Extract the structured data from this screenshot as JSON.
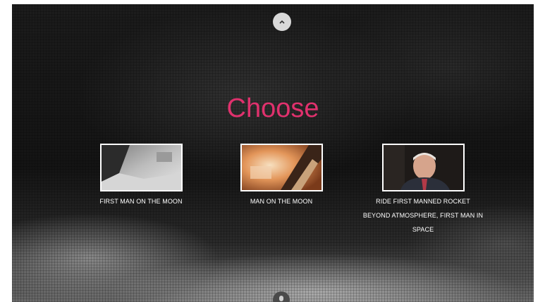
{
  "navigation": {
    "up_icon": "chevron-up-icon",
    "down_icon": "chevron-down-icon"
  },
  "heading": {
    "title": "Choose",
    "color": "#e0316d"
  },
  "options": [
    {
      "label": "FIRST MAN ON THE MOON",
      "image": "moon-surface-thumbnail"
    },
    {
      "label": "MAN ON THE MOON",
      "image": "rocket-launch-thumbnail"
    },
    {
      "label": "RIDE FIRST MANNED ROCKET BEYOND ATMOSPHERE, FIRST MAN IN SPACE",
      "image": "interview-portrait-thumbnail"
    }
  ]
}
